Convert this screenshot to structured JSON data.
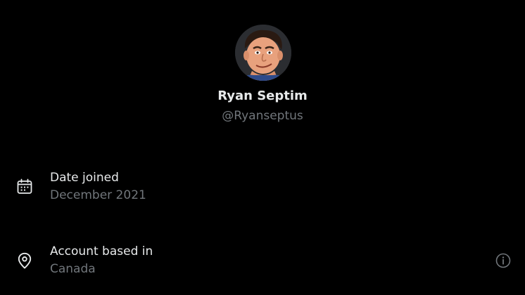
{
  "profile": {
    "display_name": "Ryan Septim",
    "handle": "@Ryanseptus"
  },
  "details": {
    "joined": {
      "label": "Date joined",
      "value": "December 2021",
      "icon": "calendar-icon"
    },
    "based_in": {
      "label": "Account based in",
      "value": "Canada",
      "icon": "location-pin-icon",
      "info_icon": "info-icon"
    }
  },
  "colors": {
    "background": "#000000",
    "primary_text": "#e7e9ea",
    "secondary_text": "#71767b"
  }
}
